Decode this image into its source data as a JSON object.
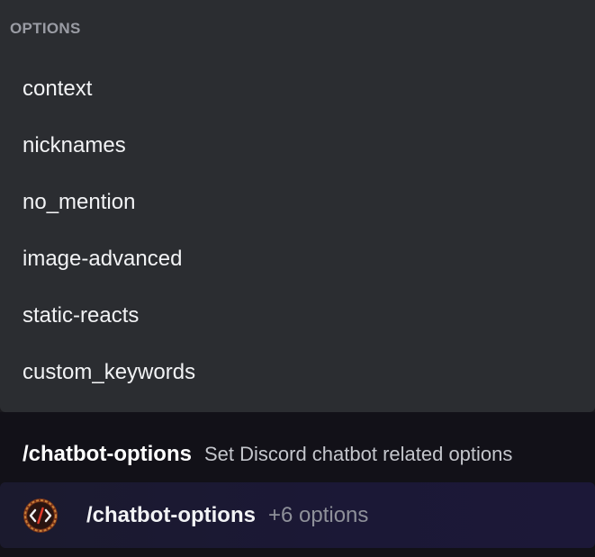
{
  "options_popup": {
    "header": "OPTIONS",
    "items": [
      {
        "label": "context"
      },
      {
        "label": "nicknames"
      },
      {
        "label": "no_mention"
      },
      {
        "label": "image-advanced"
      },
      {
        "label": "static-reacts"
      },
      {
        "label": "custom_keywords"
      }
    ]
  },
  "command_suggestion": {
    "name": "/chatbot-options",
    "description": "Set Discord chatbot related options"
  },
  "command_input": {
    "avatar_icon": "bot-avatar-icon",
    "command": "/chatbot-options",
    "extra_options": "+6 options"
  },
  "colors": {
    "popup_bg": "#2b2d31",
    "bar_bg": "#121118",
    "input_bg": "#1b1836",
    "text_primary": "#f2f3f5",
    "text_muted": "#8e9099"
  }
}
